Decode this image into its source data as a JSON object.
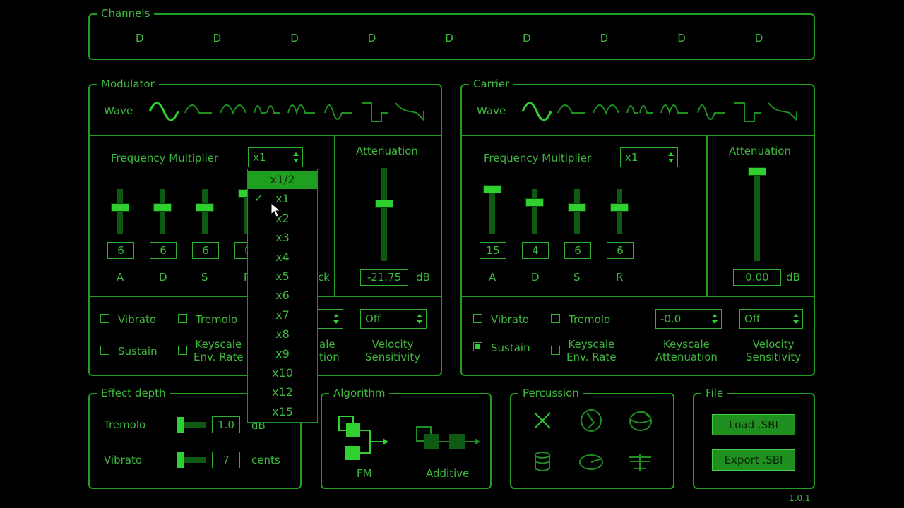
{
  "channels": {
    "title": "Channels",
    "items": [
      "D",
      "D",
      "D",
      "D",
      "D",
      "D",
      "D",
      "D",
      "D"
    ]
  },
  "modulator": {
    "title": "Modulator",
    "wave_label": "Wave",
    "freq_label": "Frequency Multiplier",
    "freq_value": "x1",
    "atten_label": "Attenuation",
    "atten_value": "-21.75",
    "atten_unit": "dB",
    "atten_level": 0.61,
    "adsr": [
      {
        "label": "A",
        "value": "6",
        "level": 0.6
      },
      {
        "label": "D",
        "value": "6",
        "level": 0.6
      },
      {
        "label": "S",
        "value": "6",
        "level": 0.6
      },
      {
        "label": "R",
        "value": "0",
        "level": 0.9
      }
    ],
    "vibrato": "Vibrato",
    "tremolo": "Tremolo",
    "sustain": "Sustain",
    "keyscale_rate": "Keyscale\nEnv. Rate",
    "keyscale_atten_partial": "ale\ntion",
    "velocity_label": "Velocity\nSensitivity",
    "velocity_value": "Off",
    "hidden_partial": "ck"
  },
  "carrier": {
    "title": "Carrier",
    "wave_label": "Wave",
    "freq_label": "Frequency Multiplier",
    "freq_value": "x1",
    "atten_label": "Attenuation",
    "atten_value": "0.00",
    "atten_unit": "dB",
    "atten_level": 1.0,
    "adsr": [
      {
        "label": "A",
        "value": "15",
        "level": 1.0
      },
      {
        "label": "D",
        "value": "4",
        "level": 0.7
      },
      {
        "label": "S",
        "value": "6",
        "level": 0.6
      },
      {
        "label": "R",
        "value": "6",
        "level": 0.6
      }
    ],
    "vibrato": "Vibrato",
    "tremolo": "Tremolo",
    "sustain": "Sustain",
    "sustain_checked": true,
    "keyscale_rate": "Keyscale\nEnv. Rate",
    "keyscale_atten_label": "Keyscale\nAttenuation",
    "keyscale_atten_value": "-0.0",
    "velocity_label": "Velocity\nSensitivity",
    "velocity_value": "Off"
  },
  "dropdown": {
    "options": [
      "x1/2",
      "x1",
      "x2",
      "x3",
      "x4",
      "x5",
      "x6",
      "x7",
      "x8",
      "x9",
      "x10",
      "x12",
      "x15"
    ],
    "highlighted": 0,
    "checked": 1
  },
  "effect_depth": {
    "title": "Effect depth",
    "tremolo_label": "Tremolo",
    "tremolo_value": "1.0",
    "tremolo_unit": "dB",
    "vibrato_label": "Vibrato",
    "vibrato_value": "7",
    "vibrato_unit": "cents"
  },
  "algorithm": {
    "title": "Algorithm",
    "fm": "FM",
    "additive": "Additive"
  },
  "percussion": {
    "title": "Percussion"
  },
  "file": {
    "title": "File",
    "load": "Load .SBI",
    "export": "Export .SBI"
  },
  "version": "1.0.1",
  "colors": {
    "accent": "#1fa01f",
    "text": "#3fb83f",
    "bright": "#2fd02f",
    "dim": "#0f5a12"
  }
}
